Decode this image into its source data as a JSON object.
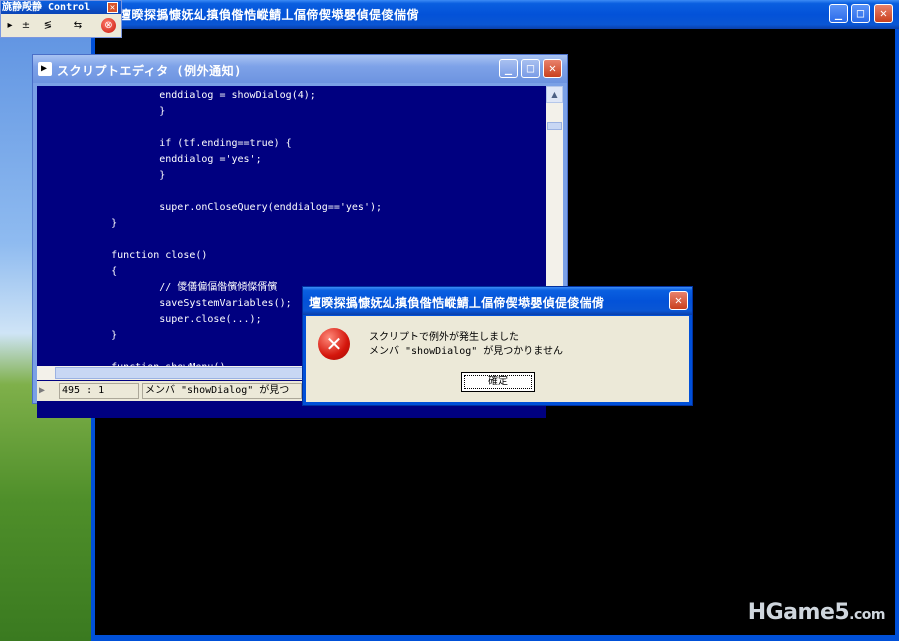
{
  "main_window": {
    "title": "壇暌探撝慷妩乣搷偩偺悎嵷鯖丄偪偙偰塨嬰偵偍倰偳偝",
    "controls": [
      "minimize-icon",
      "maximize-icon",
      "close-icon"
    ]
  },
  "control_palette": {
    "title": "旐静殸静 Control",
    "tools": [
      "▸",
      "±",
      "≶",
      "⇆",
      "⊗"
    ]
  },
  "editor": {
    "title": "スクリプトエディタ (例外通知)",
    "code_lines": [
      "            enddialog = showDialog(4);",
      "            }",
      "",
      "            if (tf.ending==true) {",
      "            enddialog ='yes';",
      "            }",
      "",
      "            super.onCloseQuery(enddialog=='yes');",
      "    }",
      "",
      "    function close()",
      "    {",
      "            // 儍僐偏偪偺儐傾儏偦儐",
      "            saveSystemVariables();",
      "            super.close(...);",
      "    }",
      "",
      "    function showMenu()"
    ],
    "status_position": "495 : 1",
    "status_message": "メンバ \"showDialog\" が見つ"
  },
  "dialog": {
    "title": "壇暌探撝慷妩乣搷偩偺悎嵷鯖丄偪偙偰塨嬰偵偍倰偳偝",
    "message_line1": "スクリプトで例外が発生しました",
    "message_line2": "メンバ \"showDialog\" が見つかりません",
    "ok_label": "確定"
  },
  "watermark": {
    "text": "HGame5",
    "suffix": ".com"
  },
  "colors": {
    "editor_bg": "#000080",
    "main_client_bg": "#000000",
    "xp_blue": "#0a56d4"
  }
}
